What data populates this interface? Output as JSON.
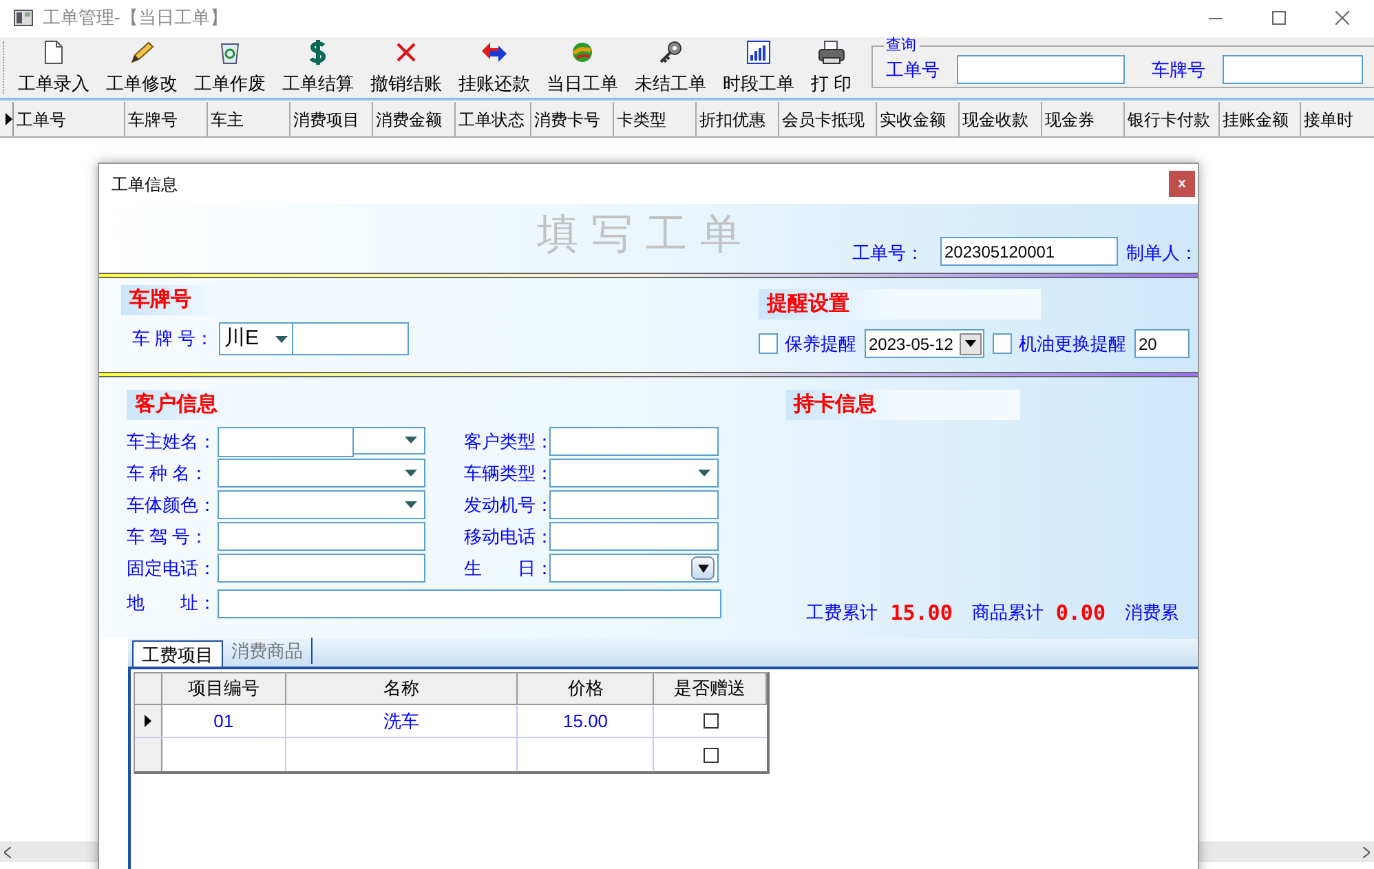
{
  "window": {
    "title": "工单管理-【当日工单】"
  },
  "toolbar": [
    {
      "label": "工单录入"
    },
    {
      "label": "工单修改"
    },
    {
      "label": "工单作废"
    },
    {
      "label": "工单结算"
    },
    {
      "label": "撤销结账"
    },
    {
      "label": "挂账还款"
    },
    {
      "label": "当日工单"
    },
    {
      "label": "未结工单"
    },
    {
      "label": "时段工单"
    },
    {
      "label": "打 印"
    }
  ],
  "query": {
    "legend": "查询",
    "fields": [
      {
        "label": "工单号"
      },
      {
        "label": "车牌号"
      }
    ]
  },
  "grid": {
    "columns": [
      "工单号",
      "车牌号",
      "车主",
      "消费项目",
      "消费金额",
      "工单状态",
      "消费卡号",
      "卡类型",
      "折扣优惠",
      "会员卡抵现",
      "实收金额",
      "现金收款",
      "现金券",
      "银行卡付款",
      "挂账金额",
      "接单时"
    ]
  },
  "dialog": {
    "title": "工单信息",
    "close": "x",
    "banner": "填 写 工 单",
    "order_no": {
      "label": "工单号：",
      "value": "202305120001"
    },
    "maker": {
      "label": "制单人："
    },
    "plate": {
      "heading": "车牌号",
      "label": "车 牌 号：",
      "prefix": "川E"
    },
    "reminder": {
      "heading": "提醒设置",
      "items": [
        {
          "label": "保养提醒",
          "checked": false,
          "date": "2023-05-12"
        },
        {
          "label": "机油更换提醒",
          "checked": false,
          "date": "20"
        }
      ]
    },
    "customer": {
      "heading": "客户信息",
      "left_fields": [
        {
          "label": "车主姓名：",
          "kind": "split"
        },
        {
          "label": "车 种 名：",
          "kind": "combo"
        },
        {
          "label": "车体颜色：",
          "kind": "combo"
        },
        {
          "label": "车 驾 号：",
          "kind": "text"
        },
        {
          "label": "固定电话：",
          "kind": "text"
        }
      ],
      "right_fields": [
        {
          "label": "客户类型：",
          "kind": "text"
        },
        {
          "label": "车辆类型：",
          "kind": "combo"
        },
        {
          "label": "发动机号：",
          "kind": "text"
        },
        {
          "label": "移动电话：",
          "kind": "text"
        },
        {
          "label": "生　　日：",
          "kind": "date"
        }
      ],
      "address": {
        "label": "地　　址："
      }
    },
    "card": {
      "heading": "持卡信息"
    },
    "totals": [
      {
        "label": "工费累计",
        "value": "15.00"
      },
      {
        "label": "商品累计",
        "value": "0.00"
      },
      {
        "label": "消费累"
      }
    ],
    "tabs": [
      {
        "label": "工费项目",
        "selected": true
      },
      {
        "label": "消费商品",
        "selected": false
      }
    ],
    "items": {
      "columns": [
        "项目编号",
        "名称",
        "价格",
        "是否赠送"
      ],
      "rows": [
        {
          "cells": [
            "01",
            "洗车",
            "15.00"
          ],
          "current": true,
          "checked": false
        },
        {
          "current": false,
          "checked": false
        }
      ]
    }
  }
}
